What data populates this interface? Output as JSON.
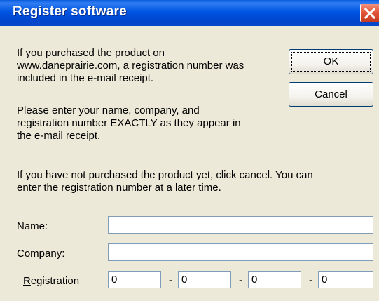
{
  "window": {
    "title": "Register software",
    "close_icon": "close-icon"
  },
  "message": {
    "paragraph1_line1": "If you purchased the product on",
    "paragraph1_line2": "www.daneprairie.com, a registration number was",
    "paragraph1_line3": "included in the e-mail receipt.",
    "paragraph2_line1": "Please enter your name, company, and",
    "paragraph2_line2": "registration number EXACTLY as they appear in",
    "paragraph2_line3": "the e-mail receipt.",
    "paragraph3_line1": "If you have not purchased the product yet, click cancel.  You can",
    "paragraph3_line2": "enter the registration number at a later time."
  },
  "buttons": {
    "ok_label": "OK",
    "cancel_label": "Cancel"
  },
  "form": {
    "name_label": "Name:",
    "name_value": "",
    "company_label": "Company:",
    "company_value": "",
    "registration_label_accel": "R",
    "registration_label_rest": "egistration",
    "separator": "-",
    "registration_values": [
      "0",
      "0",
      "0",
      "0"
    ]
  },
  "colors": {
    "titlebar": "#0054e3",
    "dialog_bg": "#ece9d8",
    "close_button": "#e2573a"
  }
}
